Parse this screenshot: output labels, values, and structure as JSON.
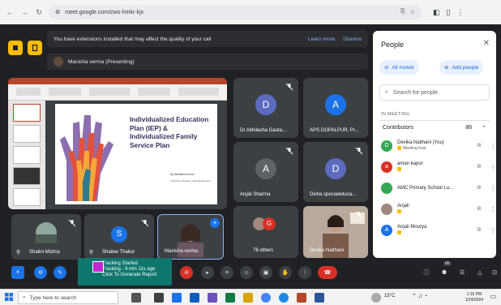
{
  "browser": {
    "url": "meet.google.com/zwo-hmkr-kjx",
    "icons": [
      "back-icon",
      "forward-icon",
      "reload-icon",
      "site-info-icon",
      "install-icon",
      "star-icon",
      "extensions-icon",
      "sidebar-icon",
      "profile-icon"
    ]
  },
  "banner": {
    "message": "You have extensions installed that may affect the quality of your call",
    "learn_more": "Learn more",
    "dismiss": "Dismiss"
  },
  "presenter": {
    "label": "Manisha verma (Presenting)"
  },
  "slide": {
    "title": "Individualized Education Plan (IEP) & Individualized Family Service Plan",
    "by": "by Manisha verma",
    "sub": "Kendriya Vidyalaya, Special Educator"
  },
  "tiles": [
    {
      "id": "d1",
      "initial": "D",
      "name": "Dr Abhilasha Gauta...",
      "color": "#5c6bc0"
    },
    {
      "id": "a1",
      "initial": "A",
      "name": "APS GOPALPUR, Pr...",
      "color": "#1a73e8"
    },
    {
      "id": "a2",
      "initial": "A",
      "name": "Anjali Sharma",
      "color": "#5f6368"
    },
    {
      "id": "d2",
      "initial": "D",
      "name": "Disha specialeduca...",
      "color": "#5c6bc0"
    },
    {
      "id": "s1",
      "initial": "",
      "name": "Shalini Mishra",
      "color": "#4e5c55"
    },
    {
      "id": "s2",
      "initial": "S",
      "name": "Shailee Thakur",
      "color": "#1a73e8"
    },
    {
      "id": "m1",
      "initial": "",
      "name": "Manisha verma",
      "color": "#7b6a66"
    },
    {
      "id": "o1",
      "initial": "",
      "name": "78 others",
      "color": "#3c4043"
    },
    {
      "id": "dn",
      "initial": "",
      "name": "Devika Naithani",
      "color": "#8a7a6e"
    }
  ],
  "people_panel": {
    "title": "People",
    "all_muted": "All muted",
    "add_people": "Add people",
    "search_placeholder": "Search for people",
    "in_meeting": "IN MEETING",
    "contributors_label": "Contributors",
    "contributors_count": "86",
    "people": [
      {
        "initial": "D",
        "name": "Devika Naithani (You)",
        "sub": "Meeting host",
        "color": "#34a853"
      },
      {
        "initial": "a",
        "name": "aman kapur",
        "sub": "",
        "color": "#d93025"
      },
      {
        "initial": "",
        "name": "AMC Primary School Lu...",
        "sub": "",
        "color": "#34a853"
      },
      {
        "initial": "",
        "name": "Anjali",
        "sub": "",
        "color": "#a1887f"
      },
      {
        "initial": "A",
        "name": "Anjali Mourya",
        "sub": "",
        "color": "#1a73e8"
      }
    ]
  },
  "tracking": {
    "line1": "Tracking Started",
    "line2": "Tracking - 9 min 11s ago",
    "line3": "Click To Generate Report"
  },
  "controls": {
    "people_badge": "86"
  },
  "taskbar": {
    "search_placeholder": "Type here to search",
    "weather": "15°C",
    "time": "1:16 PM",
    "date": "1/24/2024"
  }
}
